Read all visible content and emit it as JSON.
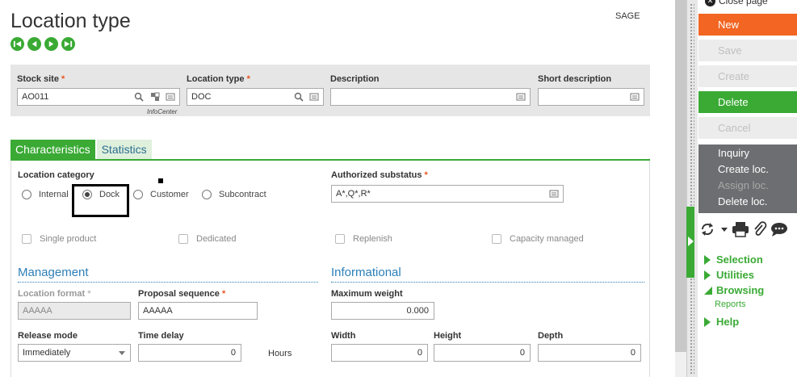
{
  "page": {
    "title": "Location type",
    "company": "SAGE",
    "infocenter": "InfoCenter"
  },
  "key_fields": {
    "stock_site": {
      "label": "Stock site",
      "value": "AO011"
    },
    "location_type": {
      "label": "Location type",
      "value": "DOC"
    },
    "description": {
      "label": "Description",
      "value": ""
    },
    "short_description": {
      "label": "Short description",
      "value": ""
    }
  },
  "tabs": [
    {
      "label": "Characteristics",
      "active": true
    },
    {
      "label": "Statistics",
      "active": false
    }
  ],
  "location_category": {
    "label": "Location category",
    "options": [
      "Internal",
      "Dock",
      "Customer",
      "Subcontract"
    ],
    "selected": "Dock"
  },
  "authorized_substatus": {
    "label": "Authorized substatus",
    "value": "A*,Q*,R*"
  },
  "checkboxes": [
    {
      "label": "Single product",
      "checked": false
    },
    {
      "label": "Dedicated",
      "checked": false
    },
    {
      "label": "Replenish",
      "checked": false
    },
    {
      "label": "Capacity managed",
      "checked": false
    }
  ],
  "management": {
    "title": "Management",
    "location_format": {
      "label": "Location format",
      "value": "AAAAA"
    },
    "proposal_sequence": {
      "label": "Proposal sequence",
      "value": "AAAAA"
    },
    "release_mode": {
      "label": "Release mode",
      "value": "Immediately"
    },
    "time_delay": {
      "label": "Time delay",
      "value": "0",
      "unit": "Hours"
    }
  },
  "informational": {
    "title": "Informational",
    "max_weight": {
      "label": "Maximum weight",
      "value": "0.000"
    },
    "width": {
      "label": "Width",
      "value": "0"
    },
    "height": {
      "label": "Height",
      "value": "0"
    },
    "depth": {
      "label": "Depth",
      "value": "0"
    }
  },
  "sidebar": {
    "close_page": "Close page",
    "new": "New",
    "save": "Save",
    "create": "Create",
    "delete": "Delete",
    "cancel": "Cancel",
    "actions": [
      {
        "label": "Inquiry",
        "enabled": true
      },
      {
        "label": "Create loc.",
        "enabled": true
      },
      {
        "label": "Assign loc.",
        "enabled": false
      },
      {
        "label": "Delete loc.",
        "enabled": true
      }
    ],
    "menus": [
      "Selection",
      "Utilities",
      "Browsing",
      "Help"
    ],
    "reports": "Reports"
  },
  "colors": {
    "accent": "#3aaa35",
    "new_button": "#f26522",
    "dark_panel": "#6d6e71",
    "required": "#e8541f",
    "section": "#2c7fb8"
  }
}
